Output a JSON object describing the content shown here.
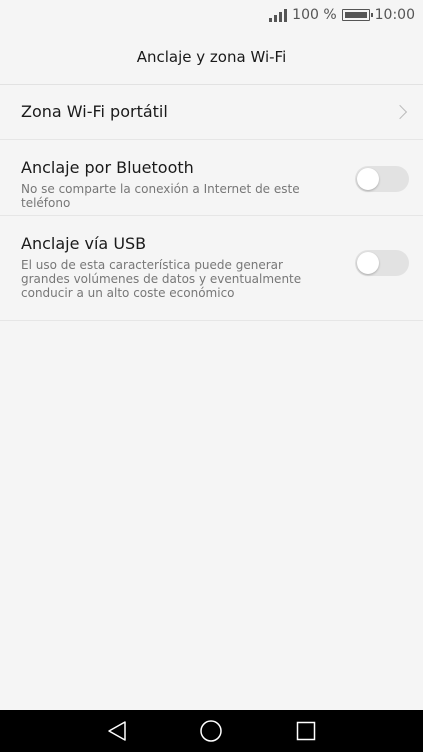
{
  "status_bar": {
    "battery_percent": "100 %",
    "time": "10:00",
    "icons": [
      "signal-icon",
      "battery-icon"
    ]
  },
  "header": {
    "title": "Anclaje y zona Wi-Fi"
  },
  "settings": [
    {
      "id": "hotspot",
      "title": "Zona Wi-Fi portátil",
      "description": "",
      "control": "chevron"
    },
    {
      "id": "bluetooth",
      "title": "Anclaje por Bluetooth",
      "description": "No se comparte la conexión a Internet de este teléfono",
      "control": "toggle",
      "enabled": false
    },
    {
      "id": "usb",
      "title": "Anclaje vía USB",
      "description": "El uso de esta característica puede generar grandes volúmenes de datos y eventualmente conducir a un alto coste económico",
      "control": "toggle",
      "enabled": false
    }
  ],
  "nav_bar": {
    "buttons": [
      "back-icon",
      "home-icon",
      "recents-icon"
    ]
  },
  "colors": {
    "background": "#f5f5f5",
    "divider": "#e6e6e6",
    "toggle_off": "#e2e2e2",
    "nav_bar": "#000000"
  }
}
